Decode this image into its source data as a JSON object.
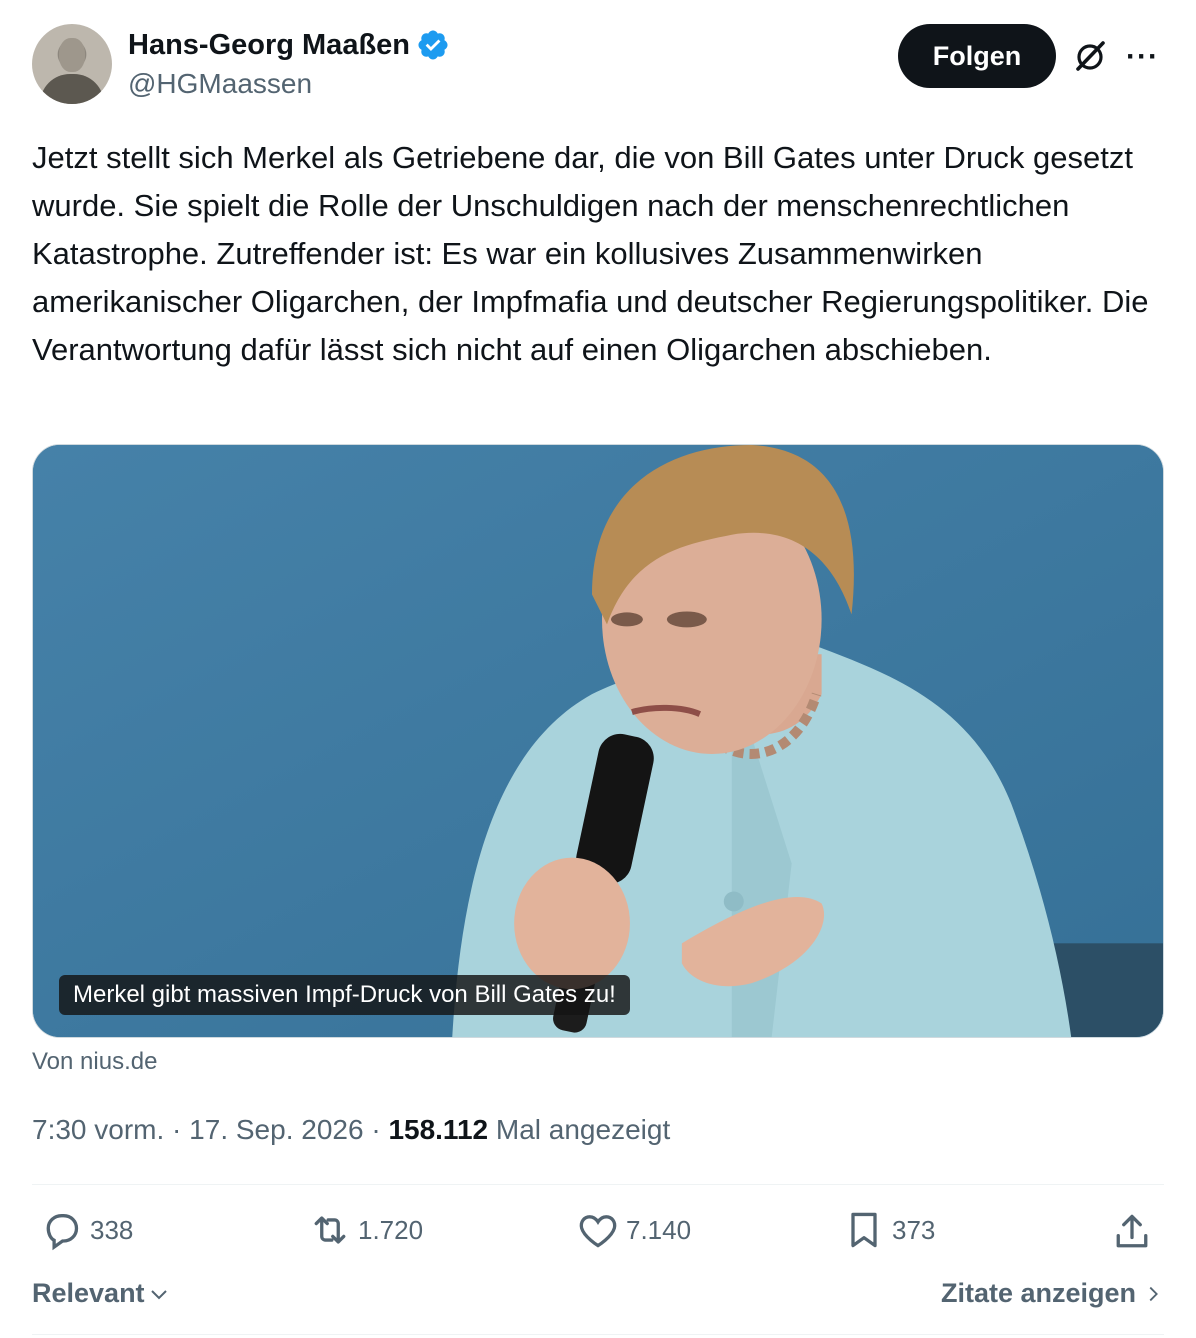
{
  "author": {
    "display_name": "Hans-Georg Maaßen",
    "handle": "@HGMaassen",
    "verified": true
  },
  "header": {
    "follow_label": "Folgen",
    "grok_icon": "grok-icon",
    "more_icon": "more-icon"
  },
  "tweet": {
    "text": "Jetzt stellt sich Merkel als Getriebene dar, die von Bill Gates unter Druck gesetzt wurde. Sie spielt die Rolle der Unschuldigen nach der menschenrechtlichen Katastrophe. Zutreffender ist: Es war ein kollusives Zusammenwirken amerikanischer Oligarchen, der Impfmafia und deutscher Regierungspolitiker. Die Verantwortung dafür lässt sich nicht auf einen Oligarchen abschieben."
  },
  "media": {
    "caption": "Merkel gibt massiven Impf-Druck von Bill Gates zu!",
    "source": "Von nius.de"
  },
  "meta": {
    "time": "7:30 vorm.",
    "separator": " · ",
    "date": "17. Sep. 2026",
    "views_count": "158.112",
    "views_label": "Mal angezeigt"
  },
  "actions": {
    "replies": "338",
    "reposts": "1.720",
    "likes": "7.140",
    "bookmarks": "373"
  },
  "footer": {
    "sort_label": "Relevant",
    "quotes_label": "Zitate anzeigen"
  },
  "colors": {
    "accent": "#1d9bf0",
    "text_primary": "#0f1419",
    "text_secondary": "#536471"
  }
}
